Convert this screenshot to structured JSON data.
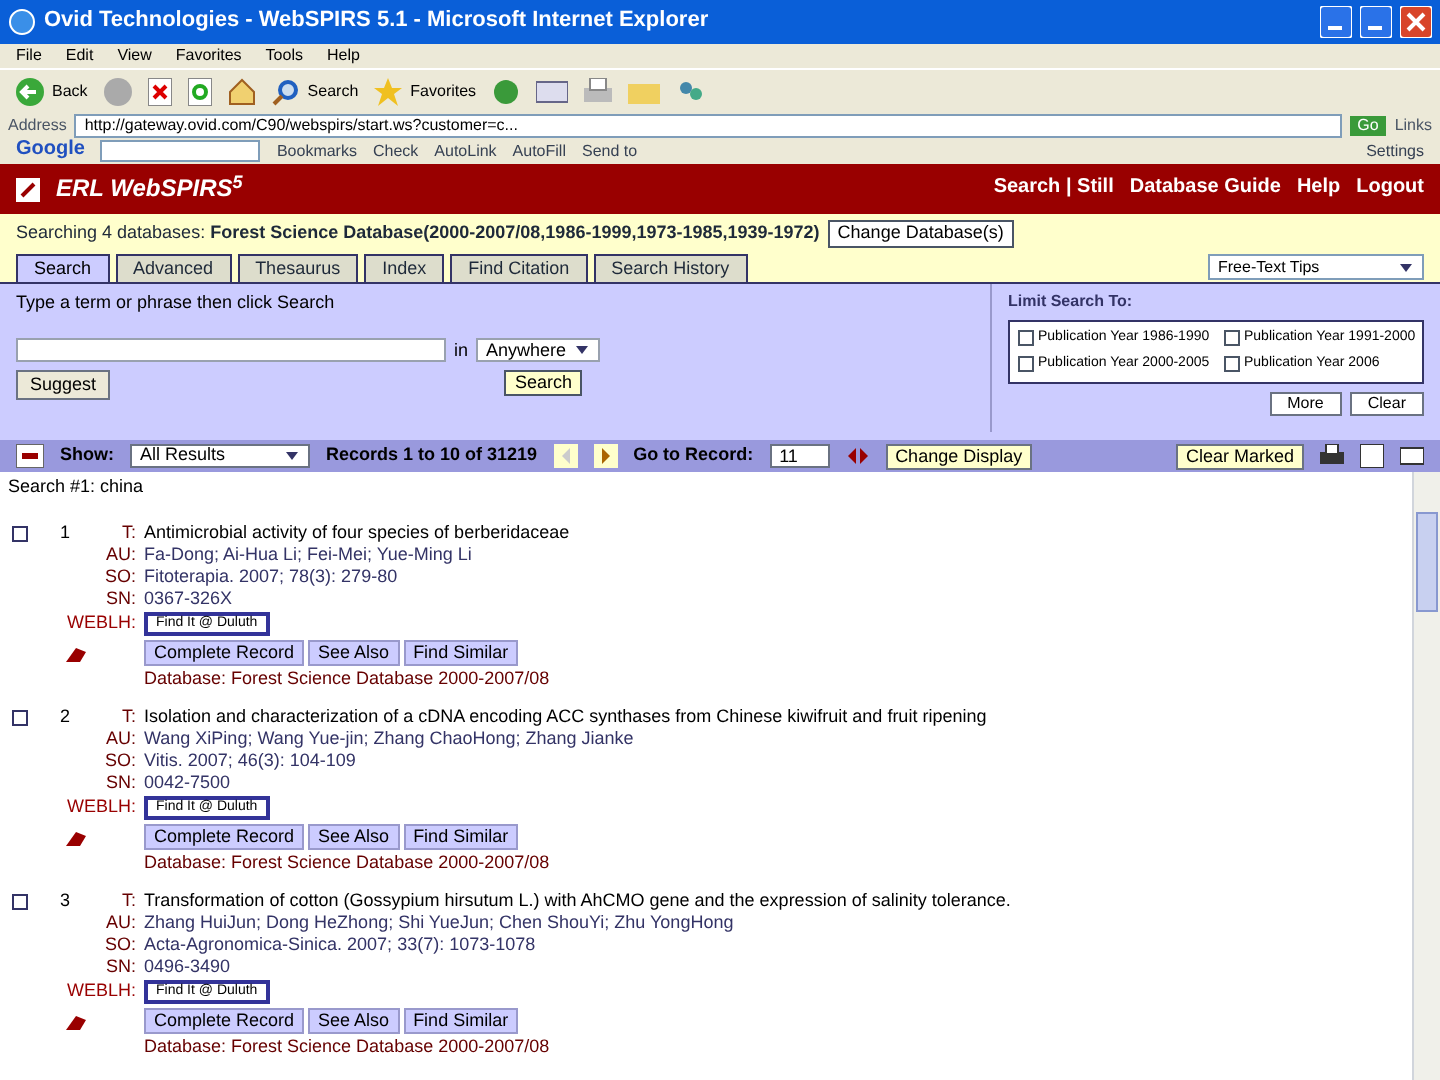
{
  "window": {
    "title": "Ovid Technologies - WebSPIRS 5.1 - Microsoft Internet Explorer"
  },
  "menu": [
    "File",
    "Edit",
    "View",
    "Favorites",
    "Tools",
    "Help"
  ],
  "toolbar": {
    "back": "Back",
    "search": "Search",
    "favorites": "Favorites"
  },
  "address_bar": {
    "label": "Address",
    "url": "http://gateway.ovid.com/C90/webspirs/start.ws?customer=c...",
    "go": "Go",
    "links": "Links"
  },
  "google_bar": {
    "logo": "Google",
    "items": [
      "Bookmarks",
      "Check",
      "AutoLink",
      "AutoFill",
      "Send to"
    ],
    "settings": "Settings"
  },
  "header": {
    "logo": "ERL WebSPIRS",
    "version": "5",
    "links": [
      "Search | Still",
      "Database Guide",
      "Help",
      "Logout"
    ]
  },
  "databases": {
    "prefix": "Searching 4 databases:",
    "names": "Forest Science Database(2000-2007/08,1986-1999,1973-1985,1939-1972)",
    "button": "Change Database(s)"
  },
  "tabs": [
    {
      "label": "Search",
      "selected": true
    },
    {
      "label": "Advanced",
      "selected": false
    },
    {
      "label": "Thesaurus",
      "selected": false
    },
    {
      "label": "Index",
      "selected": false
    },
    {
      "label": "Find Citation",
      "selected": false
    },
    {
      "label": "Search History",
      "selected": false
    }
  ],
  "tips_select": "Free-Text Tips",
  "search": {
    "instruction": "Type a term or phrase then click Search",
    "in": "in",
    "field": "Anywhere",
    "suggest": "Suggest",
    "submit": "Search"
  },
  "limits": {
    "title": "Limit Search To:",
    "options": [
      {
        "label": "Publication Year 1986-1990",
        "checked": false
      },
      {
        "label": "Publication Year 1991-2000",
        "checked": false
      },
      {
        "label": "Publication Year 2000-2005",
        "checked": false
      },
      {
        "label": "Publication Year 2006",
        "checked": false
      }
    ],
    "more": "More",
    "clear": "Clear"
  },
  "records_bar": {
    "show_label": "Show:",
    "show_value": "All Results",
    "records": "Records 1 to 10 of 31219",
    "goto_label": "Go to Record:",
    "goto_value": "11",
    "change_display": "Change Display",
    "clear_marked": "Clear Marked"
  },
  "search_title": "Search #1: china",
  "results": [
    {
      "number": "1",
      "checked": false,
      "fields": [
        {
          "label": "T:",
          "value": "Antimicrobial activity of four species of berberidaceae"
        },
        {
          "label": "AU:",
          "value": "Fa-Dong; Ai-Hua Li; Fei-Mei; Yue-Ming Li"
        },
        {
          "label": "SO:",
          "value": "Fitoterapia. 2007; 78(3): 279-80"
        },
        {
          "label": "SN:",
          "value": "0367-326X"
        }
      ],
      "weblh_label": "WEBLH:",
      "weblh": "Find It @ Duluth",
      "buttons": [
        "Complete Record",
        "See Also",
        "Find Similar"
      ],
      "database": "Database: Forest Science Database 2000-2007/08"
    },
    {
      "number": "2",
      "checked": false,
      "fields": [
        {
          "label": "T:",
          "value": "Isolation and characterization of a cDNA encoding ACC synthases from Chinese kiwifruit and fruit ripening"
        },
        {
          "label": "AU:",
          "value": "Wang XiPing; Wang Yue-jin; Zhang ChaoHong; Zhang Jianke"
        },
        {
          "label": "SO:",
          "value": "Vitis. 2007; 46(3): 104-109"
        },
        {
          "label": "SN:",
          "value": "0042-7500"
        }
      ],
      "weblh_label": "WEBLH:",
      "weblh": "Find It @ Duluth",
      "buttons": [
        "Complete Record",
        "See Also",
        "Find Similar"
      ],
      "database": "Database: Forest Science Database 2000-2007/08"
    },
    {
      "number": "3",
      "checked": false,
      "fields": [
        {
          "label": "T:",
          "value": "Transformation of cotton (Gossypium hirsutum L.) with AhCMO gene and the expression of salinity tolerance."
        },
        {
          "label": "AU:",
          "value": "Zhang HuiJun; Dong HeZhong; Shi YueJun; Chen ShouYi; Zhu YongHong"
        },
        {
          "label": "SO:",
          "value": "Acta-Agronomica-Sinica. 2007; 33(7): 1073-1078"
        },
        {
          "label": "SN:",
          "value": "0496-3490"
        }
      ],
      "weblh_label": "WEBLH:",
      "weblh": "Find It @ Duluth",
      "buttons": [
        "Complete Record",
        "See Also",
        "Find Similar"
      ],
      "database": "Database: Forest Science Database 2000-2007/08"
    }
  ]
}
